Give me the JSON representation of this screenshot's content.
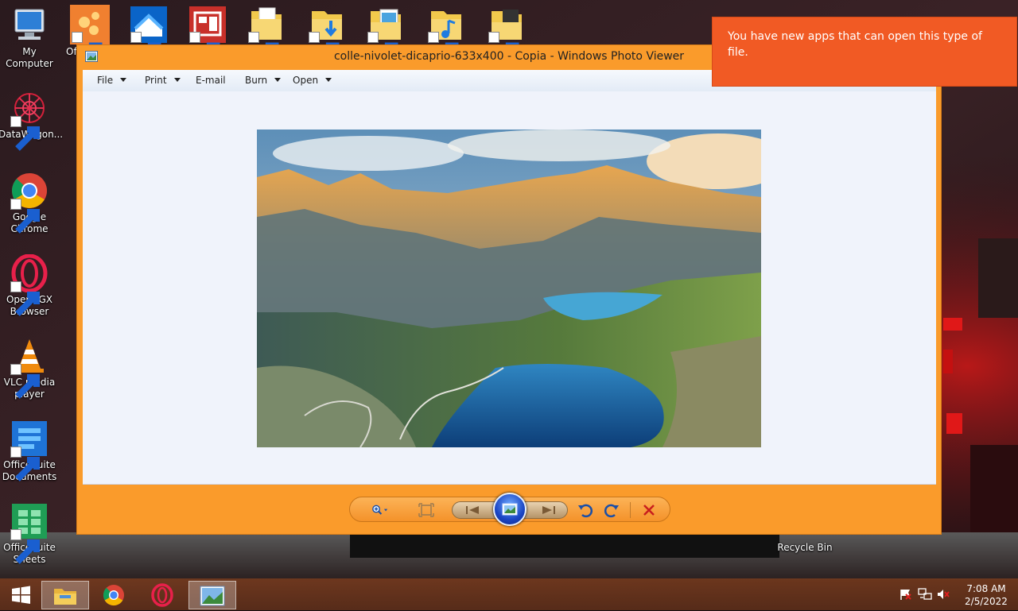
{
  "desktop": {
    "left_icons": [
      {
        "label": "My Computer",
        "icon": "computer-icon"
      },
      {
        "label": "DataWagon...",
        "icon": "datawagon-icon"
      },
      {
        "label": "Google Chrome",
        "icon": "chrome-icon"
      },
      {
        "label": "Opera GX Browser",
        "icon": "opera-gx-icon"
      },
      {
        "label": "VLC media player",
        "icon": "vlc-icon"
      },
      {
        "label": "OfficeSuite Documents",
        "icon": "officesuite-documents-icon"
      },
      {
        "label": "OfficeSuite Sheets",
        "icon": "officesuite-sheets-icon"
      }
    ],
    "partial_label": "Of",
    "recycle_bin_label": "Recycle Bin"
  },
  "window": {
    "title": "colle-nivolet-dicaprio-633x400 - Copia - Windows Photo Viewer",
    "menu": {
      "file": "File",
      "print": "Print",
      "email": "E-mail",
      "burn": "Burn",
      "open": "Open"
    },
    "controls": [
      "zoom-icon",
      "actual-size-icon",
      "previous-icon",
      "slideshow-icon",
      "next-icon",
      "rotate-left-icon",
      "rotate-right-icon",
      "delete-icon"
    ]
  },
  "notification": {
    "text": "You have new apps that can open this type of file."
  },
  "taskbar": {
    "items": [
      "windows-start-icon",
      "file-explorer-icon",
      "chrome-icon",
      "opera-gx-icon",
      "photo-viewer-icon"
    ],
    "tray": [
      "action-center-flag-icon",
      "network-icon",
      "speaker-muted-icon"
    ],
    "time": "7:08 AM",
    "date": "2/5/2022"
  },
  "colors": {
    "window_accent": "#fa9b2b",
    "toast": "#f15a24",
    "viewer_bg": "#f0f3fb"
  }
}
